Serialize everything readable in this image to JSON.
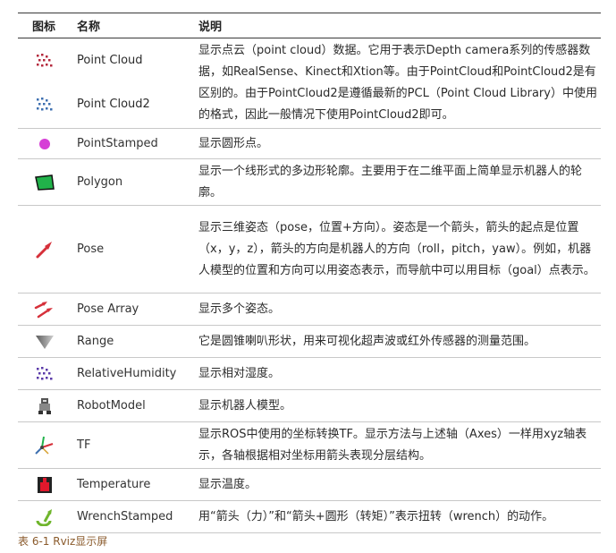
{
  "header": {
    "icon": "图标",
    "name": "名称",
    "desc": "说明"
  },
  "group_rows": {
    "items": [
      {
        "name": "Point Cloud",
        "icon": "point-cloud-icon"
      },
      {
        "name": "Point Cloud2",
        "icon": "point-cloud2-icon"
      }
    ],
    "desc": "显示点云（point cloud）数据。它用于表示Depth camera系列的传感器数据，如RealSense、Kinect和Xtion等。由于PointCloud和PointCloud2是有区别的。由于PointCloud2是遵循最新的PCL（Point Cloud Library）中使用的格式，因此一般情况下使用PointCloud2即可。"
  },
  "rows": [
    {
      "name": "PointStamped",
      "icon": "point-stamped-icon",
      "desc": "显示圆形点。"
    },
    {
      "name": "Polygon",
      "icon": "polygon-icon",
      "desc": "显示一个线形式的多边形轮廓。主要用于在二维平面上简单显示机器人的轮廓。"
    },
    {
      "name": "Pose",
      "icon": "pose-arrow-icon",
      "desc": "显示三维姿态（pose，位置+方向）。姿态是一个箭头，箭头的起点是位置（x，y，z），箭头的方向是机器人的方向（roll，pitch，yaw）。例如，机器人模型的位置和方向可以用姿态表示，而导航中可以用目标（goal）点表示。"
    },
    {
      "name": "Pose Array",
      "icon": "pose-array-icon",
      "desc": "显示多个姿态。"
    },
    {
      "name": "Range",
      "icon": "range-cone-icon",
      "desc": "它是圆锥喇叭形状，用来可视化超声波或红外传感器的测量范围。"
    },
    {
      "name": "RelativeHumidity",
      "icon": "relative-humidity-icon",
      "desc": "显示相对湿度。"
    },
    {
      "name": "RobotModel",
      "icon": "robot-model-icon",
      "desc": "显示机器人模型。"
    },
    {
      "name": "TF",
      "icon": "tf-axes-icon",
      "desc": "显示ROS中使用的坐标转换TF。显示方法与上述轴（Axes）一样用xyz轴表示，各轴根据相对坐标用箭头表现分层结构。"
    },
    {
      "name": "Temperature",
      "icon": "temperature-icon",
      "desc": "显示温度。"
    },
    {
      "name": "WrenchStamped",
      "icon": "wrench-stamped-icon",
      "desc": "用“箭头（力）”和“箭头+圆形（转矩）”表示扭转（wrench）的动作。"
    }
  ],
  "caption": "表 6-1 Rviz显示屏",
  "colors": {
    "caption": "#8a5a2b",
    "rule": "#3a3a3a",
    "divider": "#c8c8c8"
  }
}
